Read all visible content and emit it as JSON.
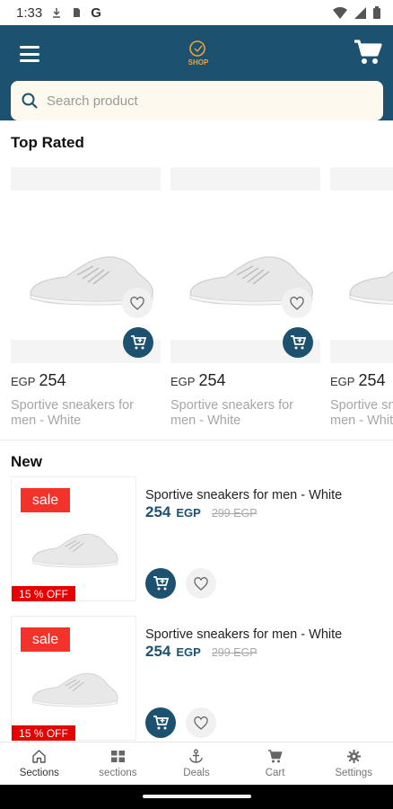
{
  "status_bar": {
    "time": "1:33",
    "g_label": "G"
  },
  "header": {
    "search_placeholder": "Search product",
    "logo_text": "SHOP"
  },
  "top_rated": {
    "title": "Top Rated",
    "items": [
      {
        "currency": "EGP",
        "price": "254",
        "name": "Sportive sneakers for men - White"
      },
      {
        "currency": "EGP",
        "price": "254",
        "name": "Sportive sneakers for men - White"
      },
      {
        "currency": "EGP",
        "price": "254",
        "name": "Sportive sneakers for men - White"
      }
    ]
  },
  "new_section": {
    "title": "New",
    "items": [
      {
        "sale": "sale",
        "discount": "15 % OFF",
        "name": "Sportive sneakers for men - White",
        "price": "254",
        "currency": "EGP",
        "old_price": "299 EGP"
      },
      {
        "sale": "sale",
        "discount": "15 % OFF",
        "name": "Sportive sneakers for men - White",
        "price": "254",
        "currency": "EGP",
        "old_price": "299 EGP"
      }
    ]
  },
  "bottom_nav": [
    {
      "label": "Sections",
      "icon": "home-icon"
    },
    {
      "label": "sections",
      "icon": "grid-icon"
    },
    {
      "label": "Deals",
      "icon": "anchor-icon"
    },
    {
      "label": "Cart",
      "icon": "cart-icon"
    },
    {
      "label": "Settings",
      "icon": "gear-icon"
    }
  ],
  "colors": {
    "primary": "#1c5170",
    "sale": "#f2322b",
    "search_bg": "#fdf9ef"
  }
}
